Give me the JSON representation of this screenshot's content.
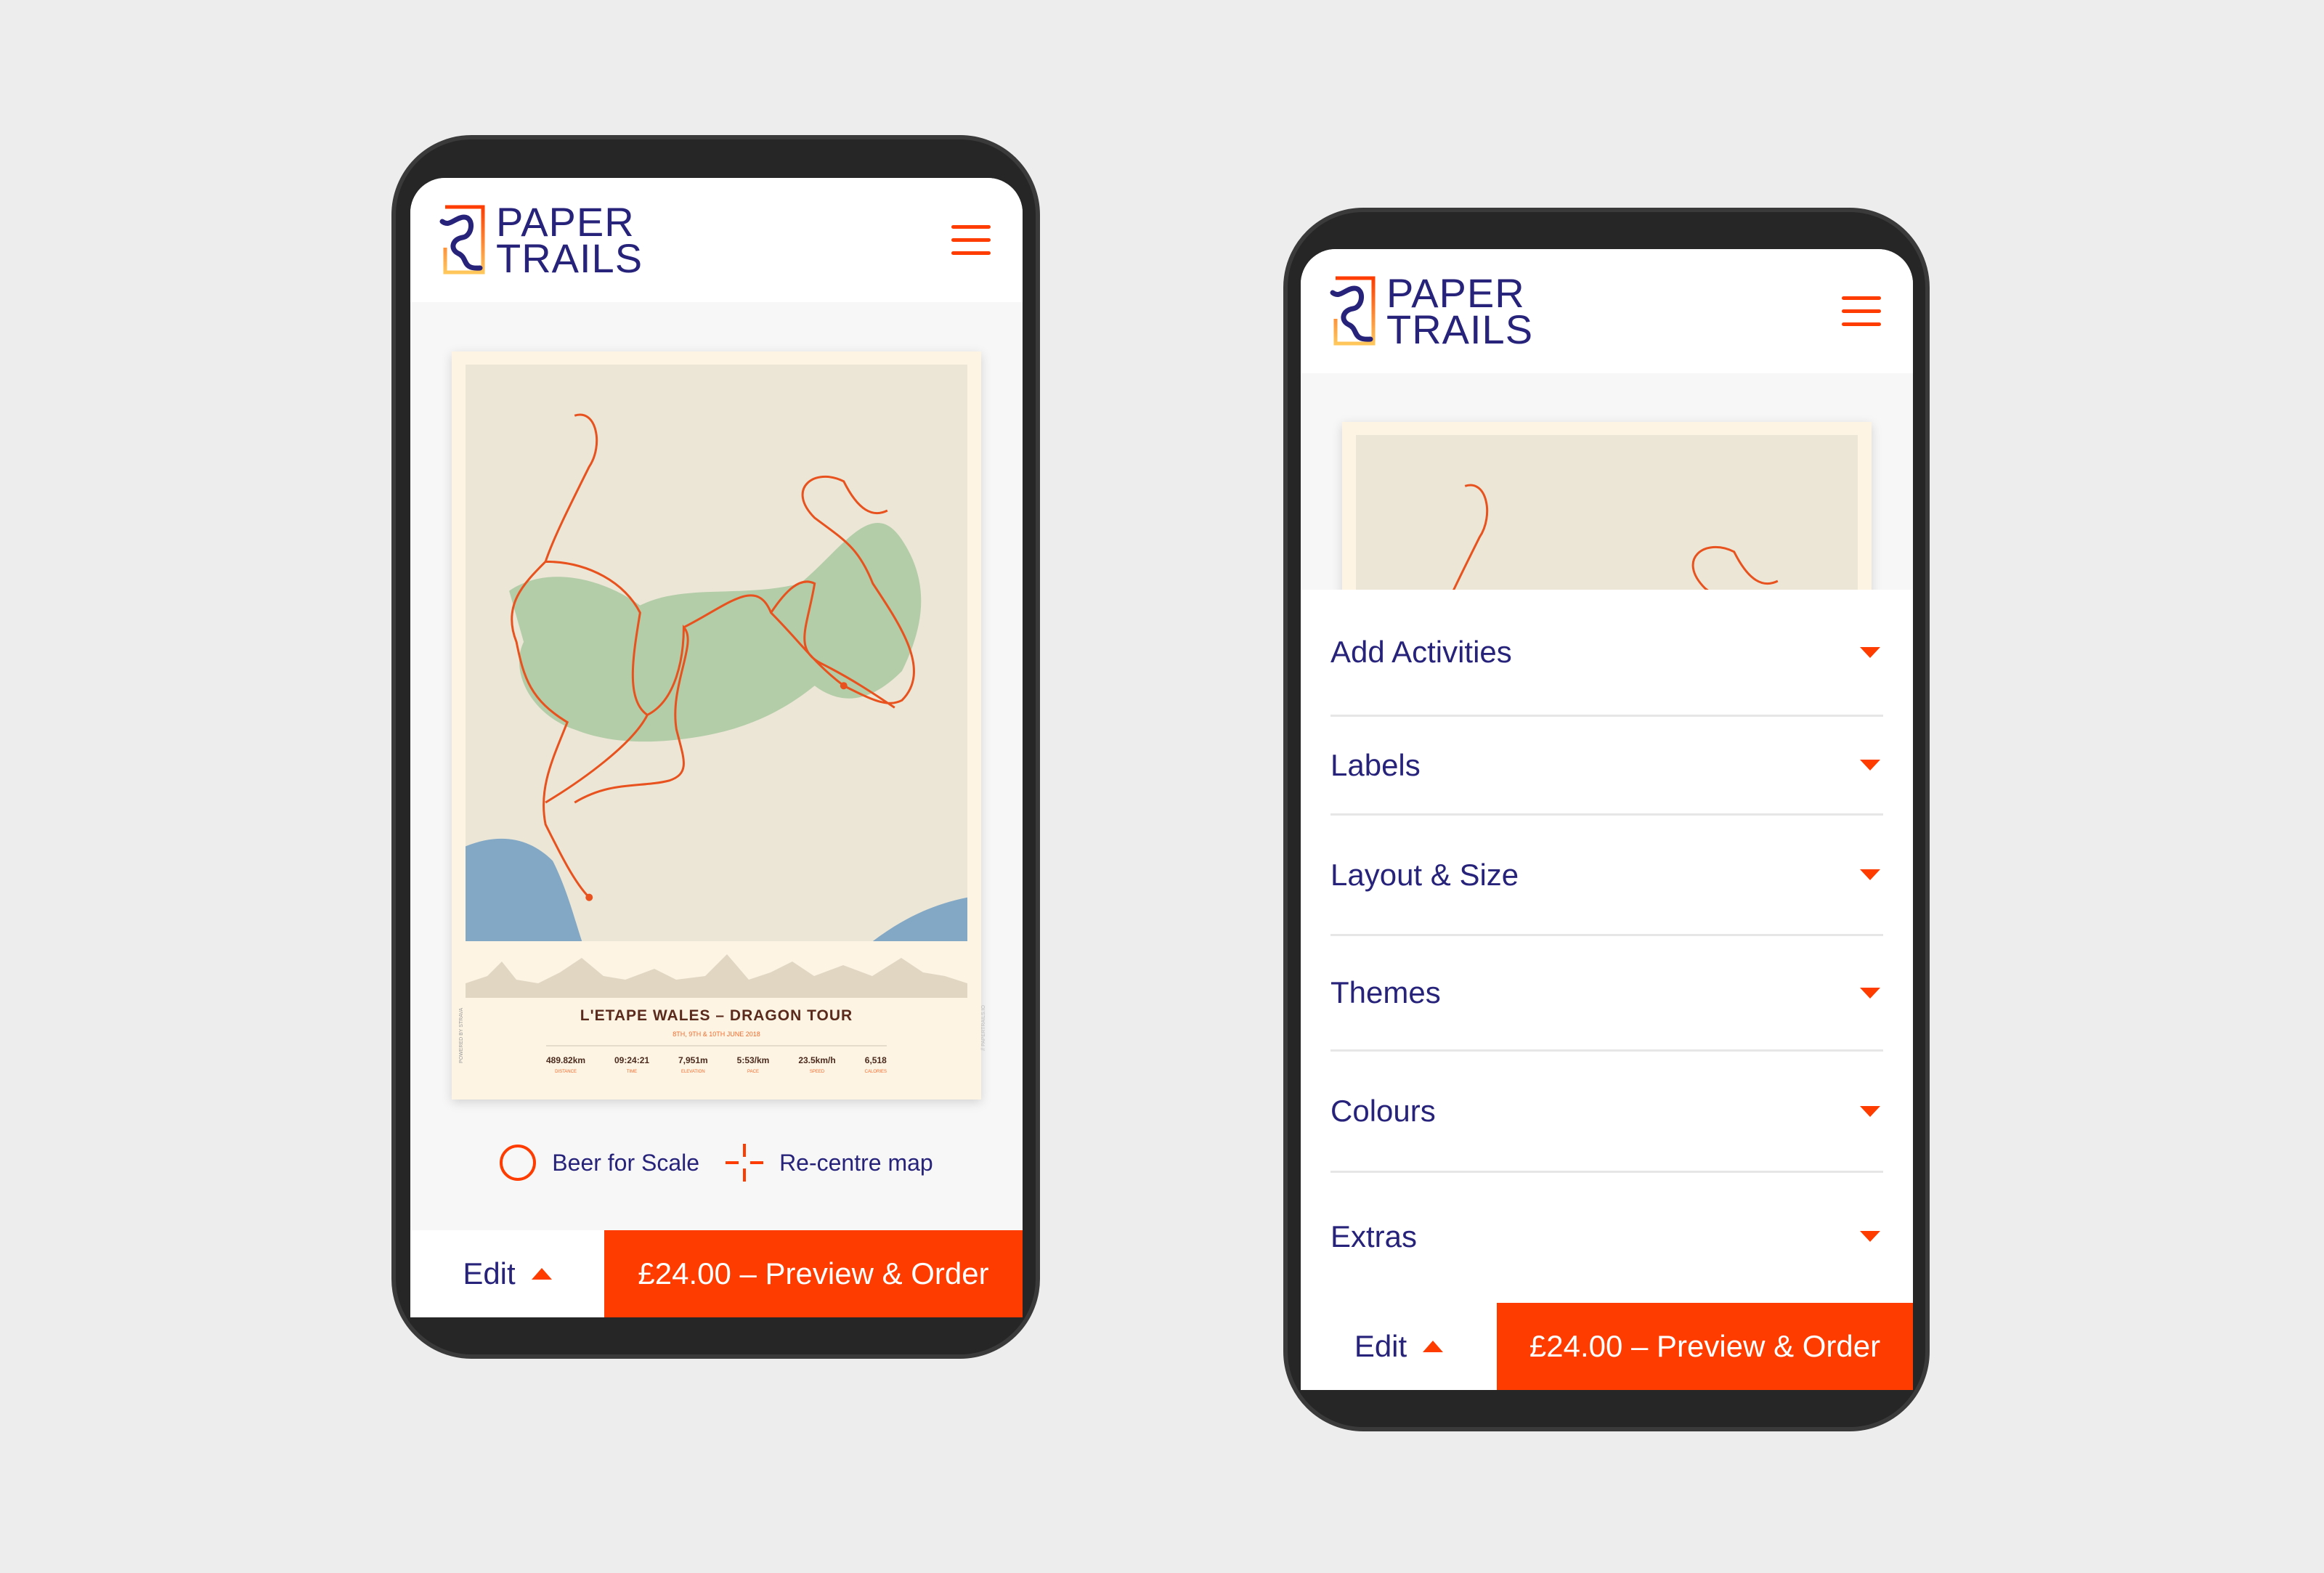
{
  "brand": {
    "logo_text_line1": "PAPER",
    "logo_text_line2": "TRAILS",
    "accent": "#ff3c00",
    "navy": "#27237a"
  },
  "poster": {
    "title": "L'ETAPE WALES – DRAGON TOUR",
    "date": "8TH, 9TH & 10TH JUNE 2018",
    "side_left": "POWERED BY STRAVA",
    "side_right": "// PAPERTRAILS.IO",
    "stats": [
      {
        "value": "489.82km",
        "label": "DISTANCE"
      },
      {
        "value": "09:24:21",
        "label": "TIME"
      },
      {
        "value": "7,951m",
        "label": "ELEVATION"
      },
      {
        "value": "5:53/km",
        "label": "PACE"
      },
      {
        "value": "23.5km/h",
        "label": "SPEED"
      },
      {
        "value": "6,518",
        "label": "CALORIES"
      }
    ]
  },
  "controls": {
    "beer": "Beer for Scale",
    "recentre": "Re-centre map"
  },
  "bottom": {
    "edit": "Edit",
    "order": "£24.00 – Preview & Order"
  },
  "menu": {
    "items": [
      {
        "label": "Add Activities"
      },
      {
        "label": "Labels"
      },
      {
        "label": "Layout & Size"
      },
      {
        "label": "Themes"
      },
      {
        "label": "Colours"
      },
      {
        "label": "Extras"
      }
    ]
  },
  "icons": {
    "menu": "hamburger-icon",
    "beer": "circle-icon",
    "recentre": "crosshair-icon",
    "edit": "triangle-up-icon",
    "accordion": "triangle-down-icon"
  }
}
